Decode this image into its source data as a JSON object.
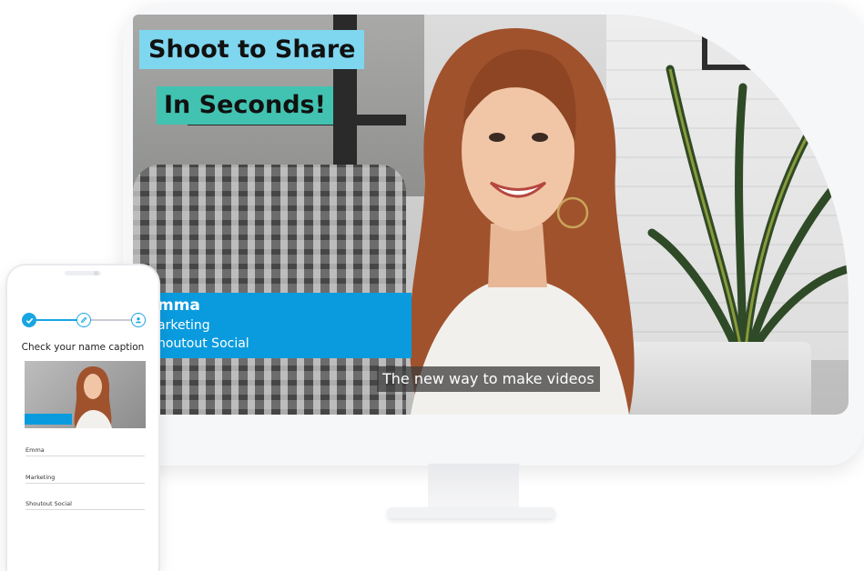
{
  "hero": {
    "headline_line1": "Shoot to Share",
    "headline_line2": "In Seconds!",
    "headline_colors": {
      "line1_bg": "#7fd6ef",
      "line2_bg": "#42c3b1"
    }
  },
  "video": {
    "lower_third": {
      "name": "mma",
      "role": "arketing",
      "company": "houtout Social",
      "color": "#0a9bde"
    },
    "subtitle": "The new way to make videos"
  },
  "phone": {
    "steps": [
      {
        "icon": "check-icon",
        "state": "complete"
      },
      {
        "icon": "edit-icon",
        "state": "active"
      },
      {
        "icon": "user-icon",
        "state": "pending"
      }
    ],
    "title": "Check your name caption",
    "fields": [
      {
        "value": "Emma"
      },
      {
        "value": "Marketing"
      },
      {
        "value": "Shoutout Social"
      }
    ],
    "accent": "#18a6e3"
  }
}
